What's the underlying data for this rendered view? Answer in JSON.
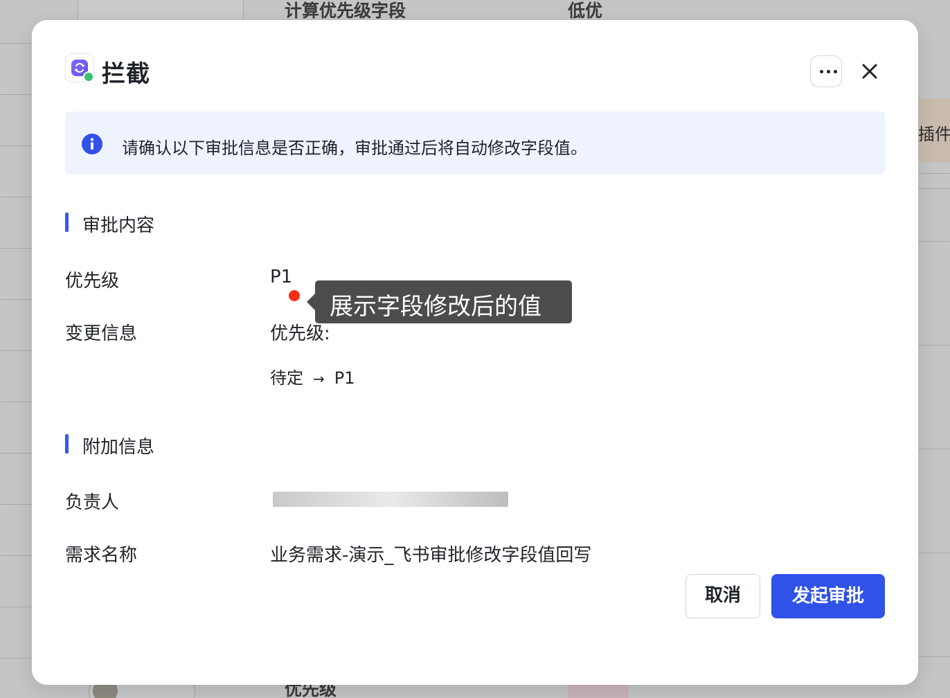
{
  "background": {
    "column_header_fragment": "",
    "field_header": "计算优先级字段",
    "value_header": "低优",
    "plugin_label": "插件",
    "footer_field": "优先级",
    "footer_person": "",
    "footer_status": ""
  },
  "dialog": {
    "title": "拦截",
    "more_icon": "more-horizontal-icon",
    "close_icon": "close-icon",
    "notice": {
      "icon": "info-icon",
      "text": "请确认以下审批信息是否正确，审批通过后将自动修改字段值。"
    },
    "approval_section": {
      "title": "审批内容",
      "priority_label": "优先级",
      "priority_value": "P1",
      "change_label": "变更信息",
      "change_field": "优先级:",
      "change_from": "待定",
      "change_arrow": "→",
      "change_to": "P1"
    },
    "tooltip": {
      "text": "展示字段修改后的值"
    },
    "extra_section": {
      "title": "附加信息",
      "owner_label": "负责人",
      "owner_value": "",
      "requirement_label": "需求名称",
      "requirement_value": "业务需求-演示_飞书审批修改字段值回写"
    },
    "buttons": {
      "cancel": "取消",
      "submit": "发起审批"
    }
  },
  "colors": {
    "primary": "#3052e8",
    "notice_bg": "#eff3fe",
    "section_bar": "#3458f0",
    "tooltip_bg": "#4b4c4e",
    "red_dot": "#fa2d16"
  }
}
